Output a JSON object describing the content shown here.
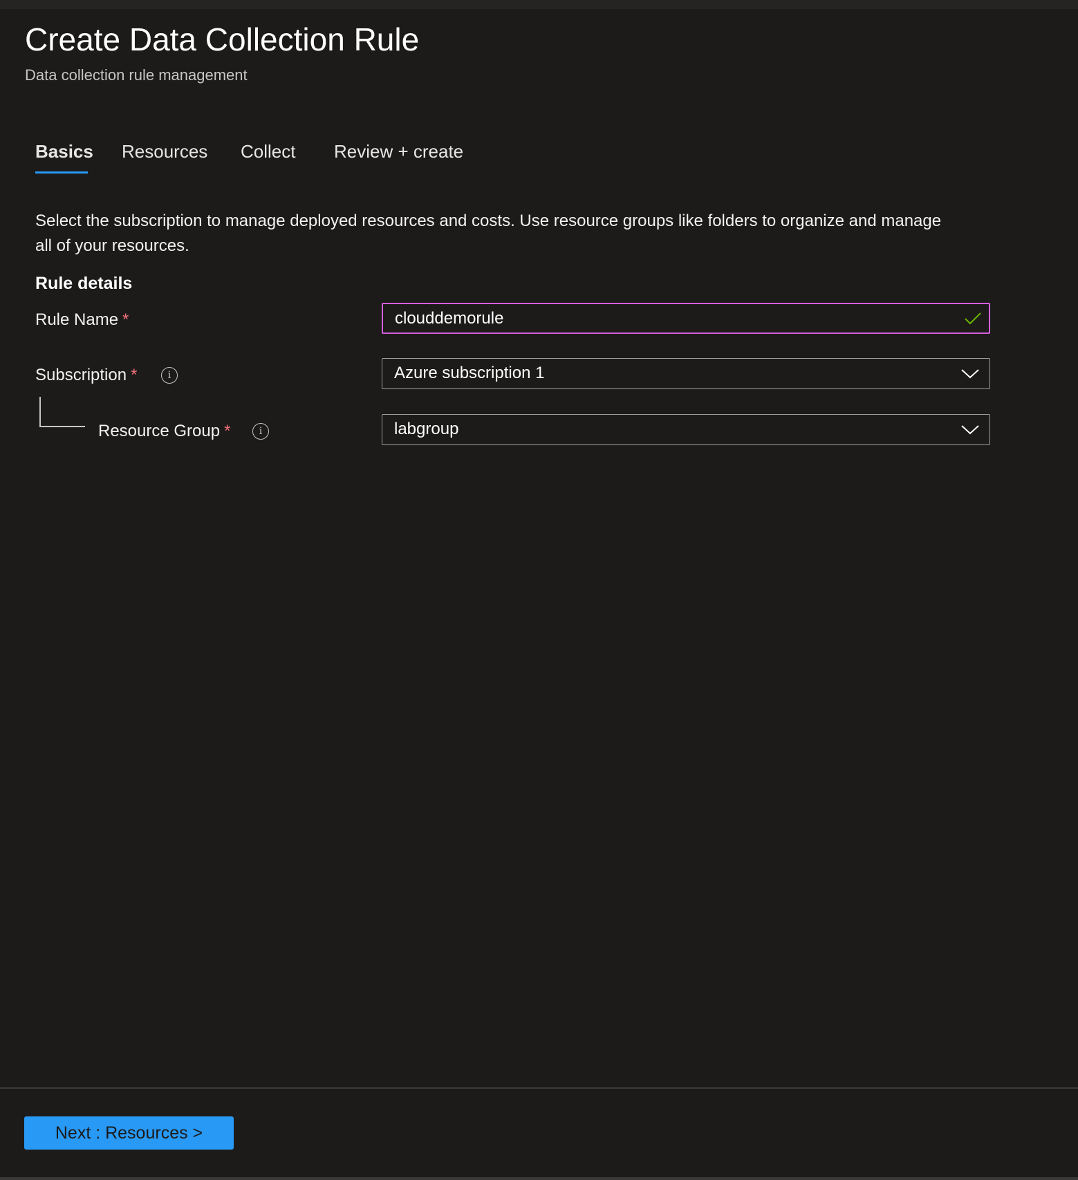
{
  "header": {
    "title": "Create Data Collection Rule",
    "subtitle": "Data collection rule management"
  },
  "tabs": [
    {
      "label": "Basics",
      "active": true
    },
    {
      "label": "Resources",
      "active": false
    },
    {
      "label": "Collect",
      "active": false
    },
    {
      "label": "Review + create",
      "active": false
    }
  ],
  "description": "Select the subscription to manage deployed resources and costs. Use resource groups like folders to organize and manage all of your resources.",
  "section_title": "Rule details",
  "form": {
    "rule_name": {
      "label": "Rule Name",
      "required": "*",
      "value": "clouddemorule",
      "valid_icon": "checkmark-icon"
    },
    "subscription": {
      "label": "Subscription",
      "required": "*",
      "info_icon": "i",
      "value": "Azure subscription 1"
    },
    "resource_group": {
      "label": "Resource Group",
      "required": "*",
      "info_icon": "i",
      "value": "labgroup"
    }
  },
  "footer": {
    "next_label": "Next : Resources >"
  },
  "colors": {
    "accent": "#2899f5",
    "focus_border": "#d55fde",
    "valid": "#6bb700",
    "required": "#f1707b",
    "background": "#1c1b1a"
  }
}
